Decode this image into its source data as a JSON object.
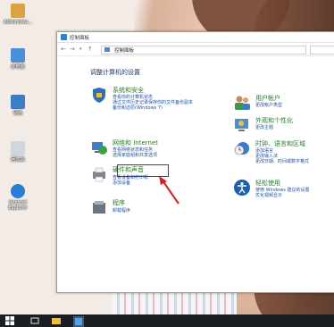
{
  "desktop": {
    "icons": [
      {
        "label": "Administra...",
        "icon": "user-folder-icon",
        "color": "#d9a441"
      },
      {
        "label": "此电脑",
        "icon": "computer-icon",
        "color": "#4a90d9"
      },
      {
        "label": "网络",
        "icon": "network-icon",
        "color": "#3b7dc7"
      },
      {
        "label": "回收站",
        "icon": "recycle-bin-icon",
        "color": "#cfd6de"
      },
      {
        "label": "Internet Explorer",
        "icon": "ie-icon",
        "color": "#2a7fd4"
      }
    ]
  },
  "window": {
    "title": "控制面板",
    "breadcrumb": "控制面板",
    "heading": "调整计算机的设置",
    "categories": [
      {
        "title": "系统和安全",
        "icon": "shield-flag-icon",
        "links": [
          "查看你的计算机状态",
          "通过文件历史记录保存你的文件备份副本",
          "备份和还原(Windows 7)"
        ]
      },
      {
        "title": "网络和 Internet",
        "icon": "network-globe-icon",
        "links": [
          "查看网络状态和任务",
          "选择家庭组和共享选项"
        ]
      },
      {
        "title": "硬件和声音",
        "icon": "printer-icon",
        "links": [
          "查看设备和打印机",
          "添加设备"
        ]
      },
      {
        "title": "程序",
        "icon": "program-box-icon",
        "links": [
          "卸载程序"
        ]
      },
      {
        "title": "用户帐户",
        "icon": "user-accounts-icon",
        "links": [
          "更改帐户类型"
        ]
      },
      {
        "title": "外观和个性化",
        "icon": "appearance-icon",
        "links": [
          "更改主题"
        ]
      },
      {
        "title": "时钟、语言和区域",
        "icon": "clock-globe-icon",
        "links": [
          "添加语言",
          "更改输入法",
          "更改日期、时间或数字格式"
        ]
      },
      {
        "title": "轻松使用",
        "icon": "ease-of-access-icon",
        "links": [
          "使用 Windows 建议的设置",
          "优化视频显示"
        ]
      }
    ]
  },
  "colors": {
    "accent": "#1e4f9c",
    "category": "#2a7a2a",
    "annotation": "#d62020"
  }
}
